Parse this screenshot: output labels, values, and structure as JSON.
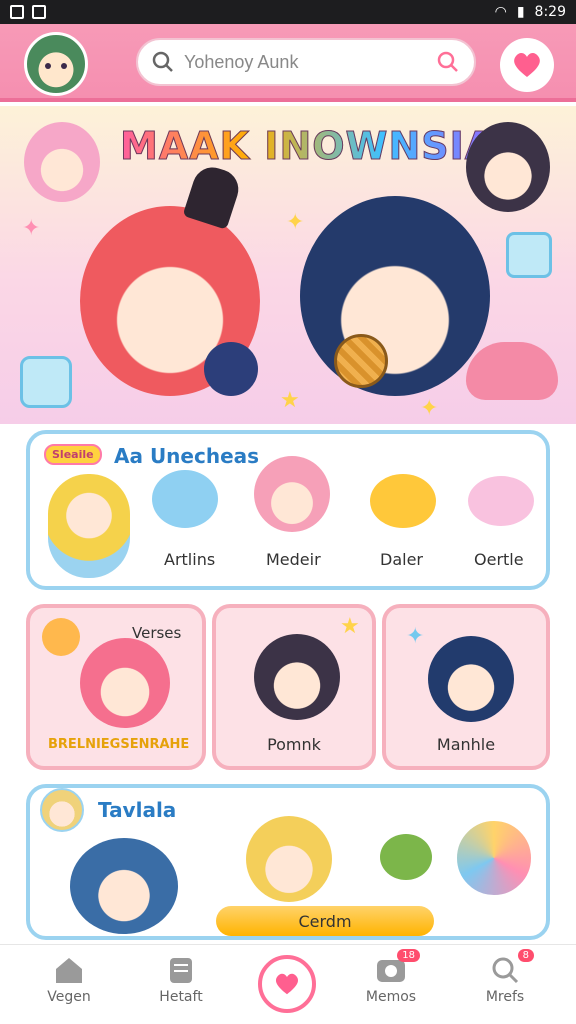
{
  "status_bar": {
    "time": "8:29"
  },
  "header": {
    "search_placeholder": "Yohenoy Aunk"
  },
  "hero": {
    "title": "MAAK INOWNSIA!"
  },
  "card_1": {
    "tag": "Sleaile",
    "title": "Aa Unecheas",
    "items": [
      "Artlins",
      "Medeir",
      "Daler",
      "Oertle"
    ]
  },
  "tiles": {
    "tile_1": {
      "label": "Verses",
      "caption": "BRELNIEGSENRAHE"
    },
    "tile_2": {
      "label": "Pomnk"
    },
    "tile_3": {
      "label": "Manhle"
    }
  },
  "card_3": {
    "title": "Tavlala",
    "button": "Cerdm"
  },
  "nav": {
    "items": [
      {
        "label": "Vegen"
      },
      {
        "label": "Hetaft"
      },
      {
        "label": "Memos",
        "badge": "18"
      },
      {
        "label": "Mrefs",
        "badge": "8"
      }
    ]
  },
  "colors": {
    "primary": "#f58fb0",
    "accent": "#9bd3f0",
    "highlight": "#ffb300"
  }
}
